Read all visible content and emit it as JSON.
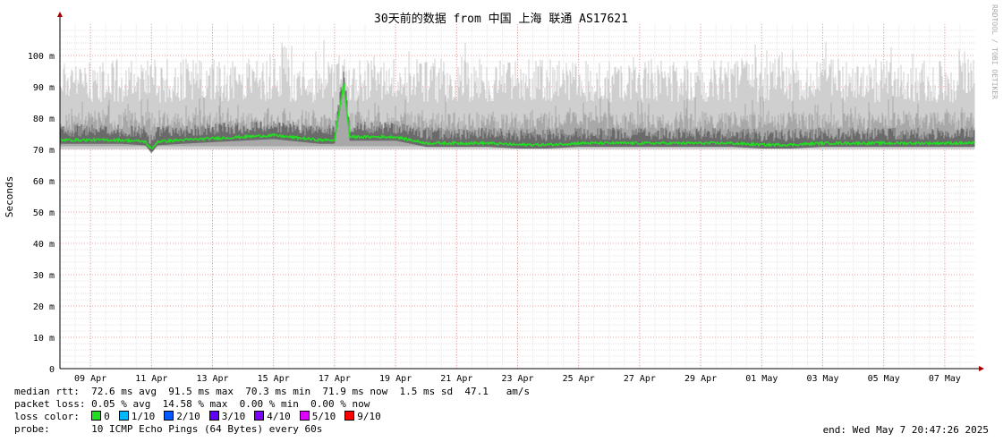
{
  "watermark": "RRDTOOL / TOBI OETIKER",
  "legend": {
    "median_rtt_label": "median rtt:",
    "median_rtt_values": "72.6 ms avg  91.5 ms max  70.3 ms min  71.9 ms now  1.5 ms sd  47.1   am/s",
    "packet_loss_label": "packet loss:",
    "packet_loss_values": "0.05 % avg  14.58 % max  0.00 % min  0.00 % now",
    "loss_color_label": "loss color:",
    "loss_colors": [
      {
        "label": "0",
        "color": "#22dd22"
      },
      {
        "label": "1/10",
        "color": "#00b8ff"
      },
      {
        "label": "2/10",
        "color": "#0059ff"
      },
      {
        "label": "3/10",
        "color": "#5e00ff"
      },
      {
        "label": "4/10",
        "color": "#7e00ff"
      },
      {
        "label": "5/10",
        "color": "#dd00ff"
      },
      {
        "label": "9/10",
        "color": "#ff0000"
      }
    ],
    "probe_label": "probe:",
    "probe_value": "10 ICMP Echo Pings (64 Bytes) every 60s",
    "end_text": "end: Wed May  7 20:47:26 2025"
  },
  "chart_data": {
    "type": "area",
    "title": "30天前的数据 from 中国 上海 联通 AS17621",
    "ylabel": "Seconds",
    "ylim": [
      0,
      110
    ],
    "yticks": [
      0,
      10,
      20,
      30,
      40,
      50,
      60,
      70,
      80,
      90,
      100
    ],
    "ytick_labels": [
      "0",
      "10 m",
      "20 m",
      "30 m",
      "40 m",
      "50 m",
      "60 m",
      "70 m",
      "80 m",
      "90 m",
      "100 m"
    ],
    "x_tick_labels": [
      "09 Apr",
      "11 Apr",
      "13 Apr",
      "15 Apr",
      "17 Apr",
      "19 Apr",
      "21 Apr",
      "23 Apr",
      "25 Apr",
      "27 Apr",
      "29 Apr",
      "01 May",
      "03 May",
      "05 May",
      "07 May"
    ],
    "x_range_days": [
      0,
      30
    ],
    "x_tick_days": [
      1,
      3,
      5,
      7,
      9,
      11,
      13,
      15,
      17,
      19,
      21,
      23,
      25,
      27,
      29
    ],
    "grid": true,
    "median_series": {
      "name": "median rtt",
      "x_days": [
        0,
        1,
        2,
        2.8,
        3.0,
        3.2,
        4,
        5,
        6,
        7,
        8,
        8.5,
        9.0,
        9.3,
        9.5,
        10,
        11,
        12,
        13,
        14,
        15,
        16,
        17,
        18,
        19,
        20,
        21,
        22,
        23,
        24,
        25,
        26,
        27,
        28,
        29,
        30
      ],
      "y_ms": [
        73,
        73,
        73,
        72.5,
        70,
        72.5,
        73,
        73.5,
        74,
        74.5,
        73.5,
        73,
        73,
        91,
        74,
        74,
        74,
        72,
        72,
        72,
        71.5,
        71.5,
        72,
        72,
        72,
        72,
        72,
        72,
        71.5,
        71.5,
        72,
        72,
        72,
        72,
        72,
        72
      ]
    },
    "smoke_bands_ms": {
      "inner": [
        71,
        82
      ],
      "outer": [
        70,
        99
      ]
    }
  }
}
